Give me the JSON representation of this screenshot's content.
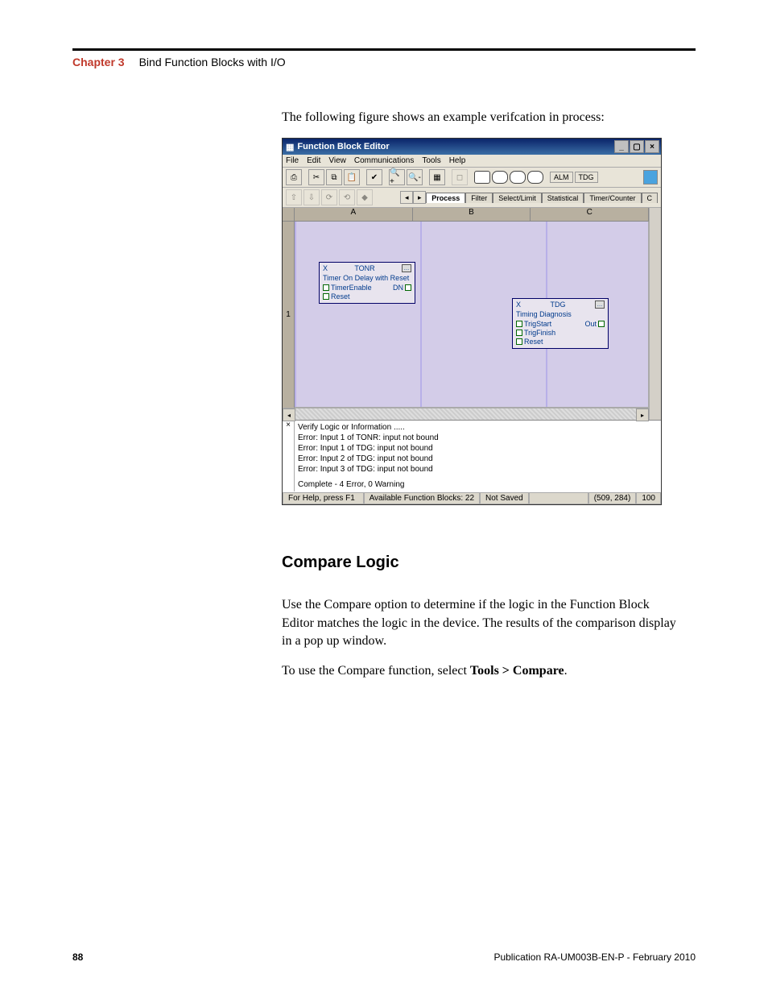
{
  "header": {
    "chapter_label": "Chapter 3",
    "chapter_title": "Bind Function Blocks with I/O"
  },
  "intro_text": "The following figure shows an example verifcation in process:",
  "app": {
    "title": "Function Block Editor",
    "menus": [
      "File",
      "Edit",
      "View",
      "Communications",
      "Tools",
      "Help"
    ],
    "toolbar": {
      "text_buttons": [
        "ALM",
        "TDG"
      ]
    },
    "tabs": {
      "items": [
        "Process",
        "Filter",
        "Select/Limit",
        "Statistical",
        "Timer/Counter",
        "C"
      ],
      "active_index": 0
    },
    "canvas": {
      "columns": [
        "A",
        "B",
        "C"
      ],
      "row_label": "1",
      "block_tonr": {
        "tag": "X",
        "name": "TONR",
        "title": "Timer On Delay with Reset",
        "rows": [
          {
            "left": "TimerEnable",
            "right": "DN"
          },
          {
            "left": "Reset",
            "right": ""
          }
        ]
      },
      "block_tdg": {
        "tag": "X",
        "name": "TDG",
        "title": "Timing Diagnosis",
        "rows": [
          {
            "left": "TrigStart",
            "right": "Out"
          },
          {
            "left": "TrigFinish",
            "right": ""
          },
          {
            "left": "Reset",
            "right": ""
          }
        ]
      }
    },
    "log": {
      "header": "Verify Logic or Information .....",
      "lines": [
        "Error:   Input 1 of TONR: input not bound",
        "Error:   Input 1 of TDG: input not bound",
        "Error:   Input 2 of TDG: input not bound",
        "Error:   Input 3 of TDG: input not bound"
      ],
      "summary": "Complete -  4 Error, 0 Warning"
    },
    "status": {
      "help": "For Help, press F1",
      "blocks": "Available Function Blocks: 22",
      "save": "Not Saved",
      "coords": "(509, 284)",
      "zoom": "100"
    }
  },
  "section": {
    "heading": "Compare Logic",
    "p1": "Use the Compare option to determine if the logic in the Function Block Editor matches the logic in the device. The results of the comparison display in a pop up window.",
    "p2_a": "To use the Compare function, select ",
    "p2_b": "Tools > Compare",
    "p2_c": "."
  },
  "footer": {
    "page": "88",
    "pub": "Publication RA-UM003B-EN-P - February 2010"
  }
}
